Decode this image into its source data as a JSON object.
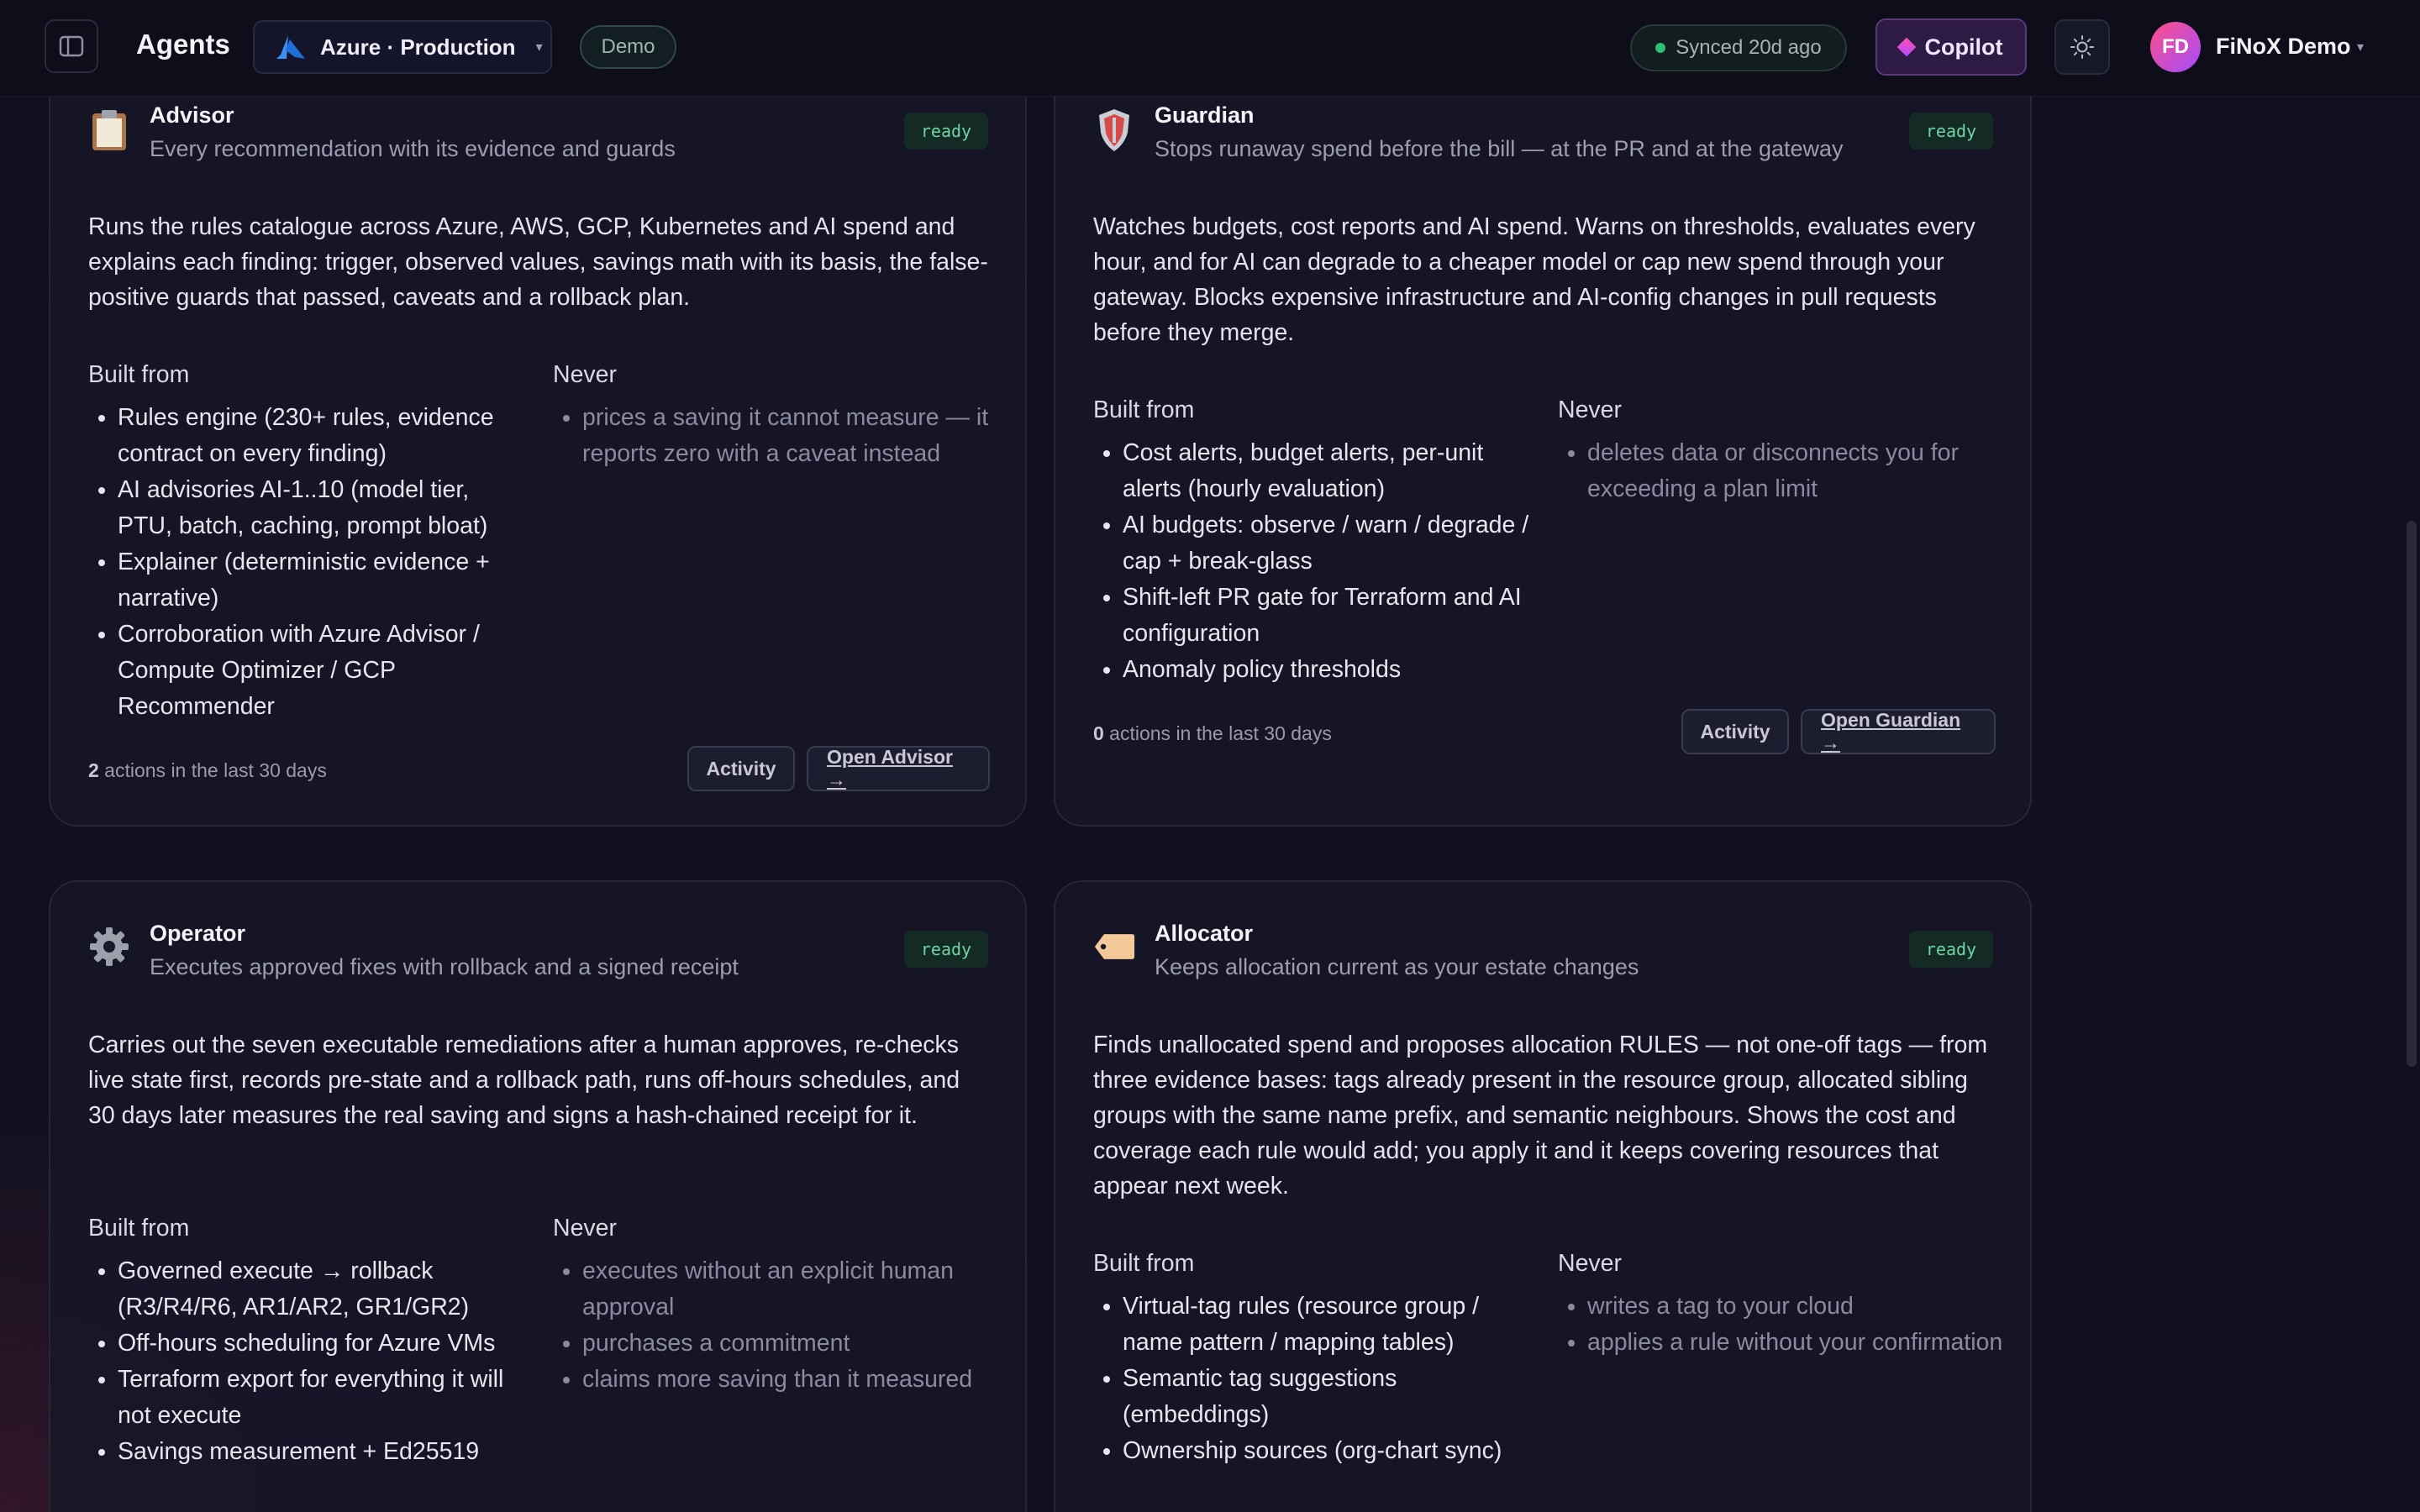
{
  "header": {
    "title": "Agents",
    "cloud": "Azure · Production",
    "cloud_chevron": "▾",
    "demo_badge": "Demo",
    "sync_status": "Synced 20d ago",
    "copilot_label": "Copilot",
    "user_initials": "FD",
    "user_name": "FiNoX Demo",
    "user_chevron": "▾",
    "colors": {
      "accent": "#b14cff",
      "sync_dot": "#2fbf73",
      "ready": "#6fd3a5"
    }
  },
  "cards": [
    {
      "name": "Advisor",
      "icon": "clipboard-icon",
      "subtitle": "Every recommendation with its evidence and guards",
      "status": "ready",
      "description": "Runs the rules catalogue across Azure, AWS, GCP, Kubernetes and AI spend and explains each finding: trigger, observed values, savings math with its basis, the false-positive guards that passed, caveats and a rollback plan.",
      "built_from_label": "Built from",
      "never_label": "Never",
      "built_from": [
        "Rules engine (230+ rules, evidence contract on every finding)",
        "AI advisories AI-1..10 (model tier, PTU, batch, caching, prompt bloat)",
        "Explainer (deterministic evidence + narrative)",
        "Corroboration with Azure Advisor / Compute Optimizer / GCP Recommender"
      ],
      "never": [
        "prices a saving it cannot measure — it reports zero with a caveat instead"
      ],
      "actions_count": "2",
      "actions_text": " actions in the last 30 days",
      "activity_label": "Activity",
      "open_label": "Open Advisor →"
    },
    {
      "name": "Guardian",
      "icon": "shield-icon",
      "subtitle": "Stops runaway spend before the bill — at the PR and at the gateway",
      "status": "ready",
      "description": "Watches budgets, cost reports and AI spend. Warns on thresholds, evaluates every hour, and for AI can degrade to a cheaper model or cap new spend through your gateway. Blocks expensive infrastructure and AI-config changes in pull requests before they merge.",
      "built_from_label": "Built from",
      "never_label": "Never",
      "built_from": [
        "Cost alerts, budget alerts, per-unit alerts (hourly evaluation)",
        "AI budgets: observe / warn / degrade / cap + break-glass",
        "Shift-left PR gate for Terraform and AI configuration",
        "Anomaly policy thresholds"
      ],
      "never": [
        "deletes data or disconnects you for exceeding a plan limit"
      ],
      "actions_count": "0",
      "actions_text": " actions in the last 30 days",
      "activity_label": "Activity",
      "open_label": "Open Guardian →"
    },
    {
      "name": "Operator",
      "icon": "gear-icon",
      "subtitle": "Executes approved fixes with rollback and a signed receipt",
      "status": "ready",
      "description": "Carries out the seven executable remediations after a human approves, re-checks live state first, records pre-state and a rollback path, runs off-hours schedules, and 30 days later measures the real saving and signs a hash-chained receipt for it.",
      "built_from_label": "Built from",
      "never_label": "Never",
      "built_from": [
        "Governed execute → rollback (R3/R4/R6, AR1/AR2, GR1/GR2)",
        "Off-hours scheduling for Azure VMs",
        "Terraform export for everything it will not execute",
        "Savings measurement + Ed25519"
      ],
      "never": [
        "executes without an explicit human approval",
        "purchases a commitment",
        "claims more saving than it measured"
      ]
    },
    {
      "name": "Allocator",
      "icon": "tag-icon",
      "subtitle": "Keeps allocation current as your estate changes",
      "status": "ready",
      "description": "Finds unallocated spend and proposes allocation RULES — not one-off tags — from three evidence bases: tags already present in the resource group, allocated sibling groups with the same name prefix, and semantic neighbours. Shows the cost and coverage each rule would add; you apply it and it keeps covering resources that appear next week.",
      "built_from_label": "Built from",
      "never_label": "Never",
      "built_from": [
        "Virtual-tag rules (resource group / name pattern / mapping tables)",
        "Semantic tag suggestions (embeddings)",
        "Ownership sources (org-chart sync)"
      ],
      "never": [
        "writes a tag to your cloud",
        "applies a rule without your confirmation"
      ]
    }
  ]
}
